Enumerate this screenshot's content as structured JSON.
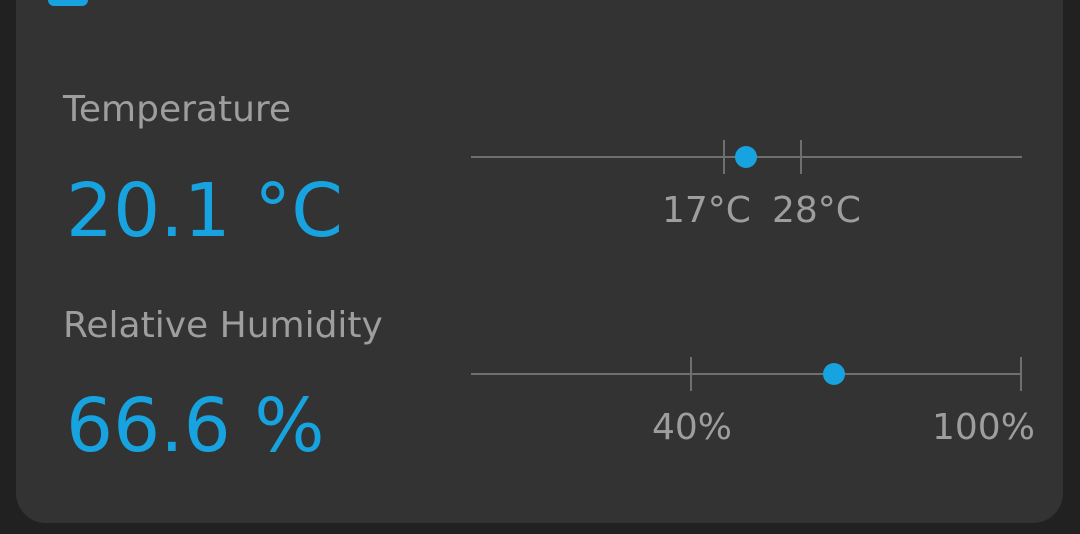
{
  "colors": {
    "accent": "#17a3df",
    "card_background": "#333333",
    "page_background": "#212121",
    "label_text": "#9e9e9e",
    "track": "#6f6f6f"
  },
  "temperature": {
    "label": "Temperature",
    "value": "20.1 °C",
    "range_low_label": "17°C",
    "range_high_label": "28°C",
    "range_low": 17,
    "range_high": 28,
    "current": 20.1,
    "indicator_icon": "dot-indicator"
  },
  "humidity": {
    "label": "Relative Humidity",
    "value": "66.6 %",
    "range_low_label": "40%",
    "range_high_label": "100%",
    "range_low": 40,
    "range_high": 100,
    "current": 66.6,
    "indicator_icon": "dot-indicator"
  }
}
